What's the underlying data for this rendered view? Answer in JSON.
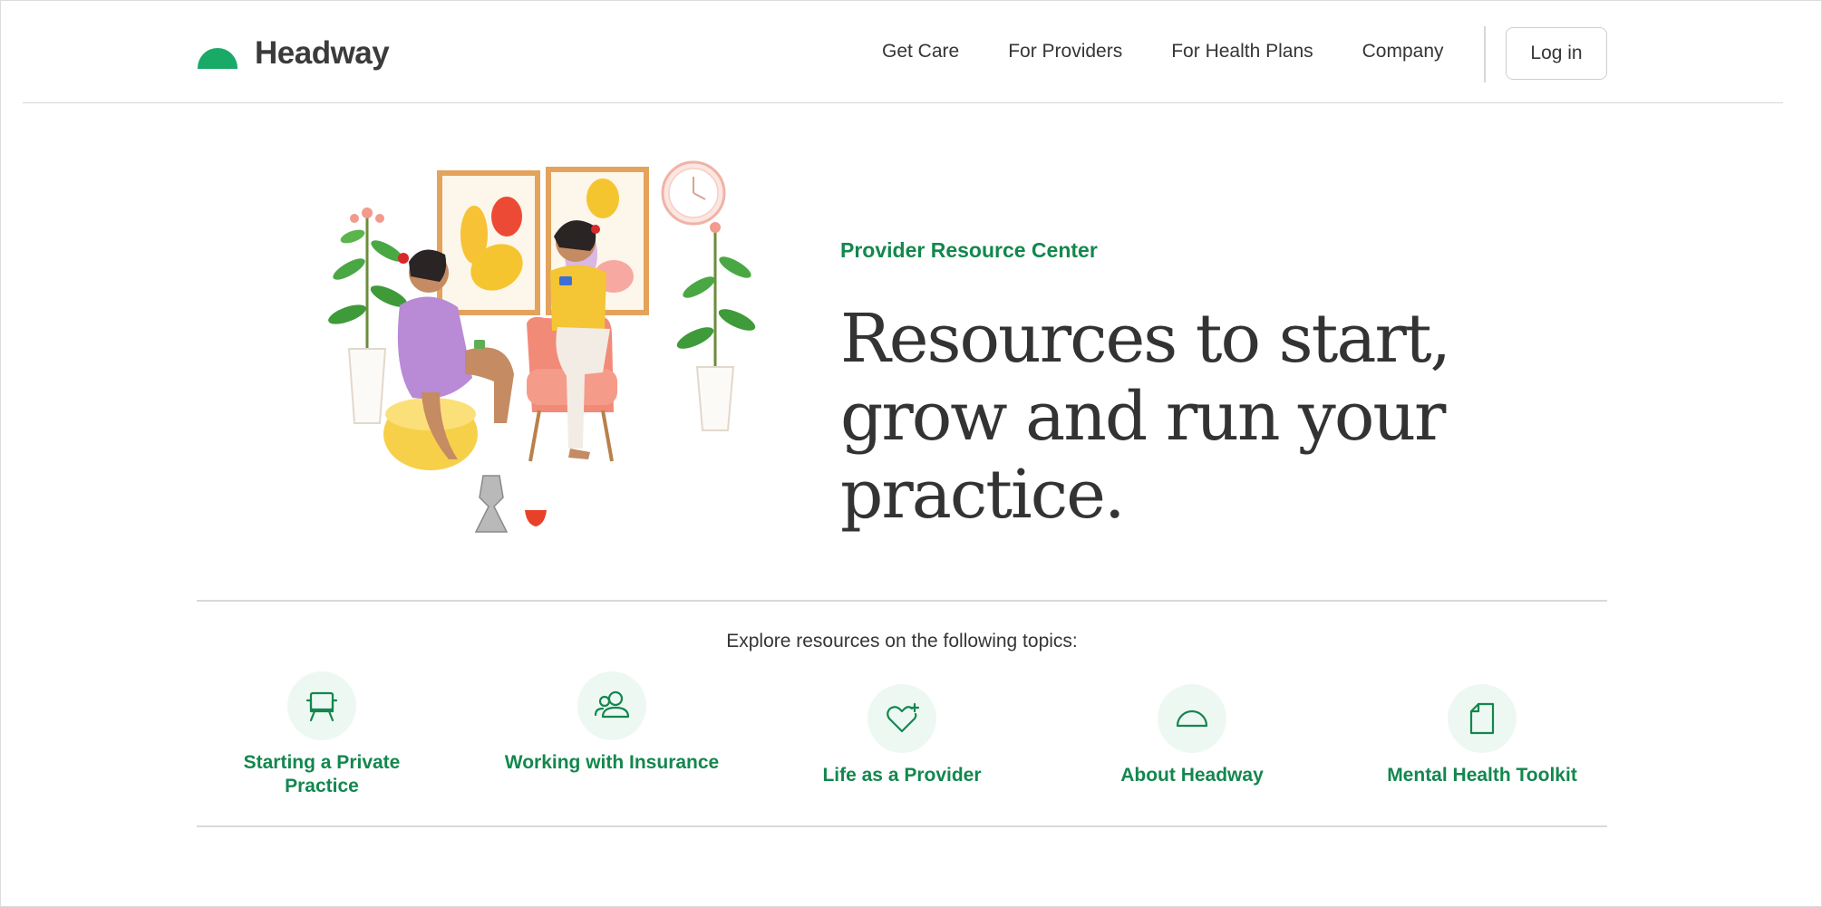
{
  "brand": {
    "name": "Headway",
    "color_primary": "#13874e",
    "color_logo": "#1aaa68"
  },
  "nav": {
    "items": [
      "Get Care",
      "For Providers",
      "For Health Plans",
      "Company"
    ],
    "login_label": "Log in"
  },
  "hero": {
    "eyebrow": "Provider Resource Center",
    "title": "Resources to start, grow and run your practice.",
    "illustration_name": "two-women-drinking-coffee-illustration"
  },
  "topics": {
    "heading": "Explore resources on the following topics:",
    "items": [
      {
        "label": "Starting a Private Practice",
        "icon": "armchair-icon"
      },
      {
        "label": "Working with Insurance",
        "icon": "people-icon"
      },
      {
        "label": "Life as a Provider",
        "icon": "heart-sparkle-icon"
      },
      {
        "label": "About Headway",
        "icon": "headway-dome-icon"
      },
      {
        "label": "Mental Health Toolkit",
        "icon": "document-icon"
      }
    ]
  }
}
